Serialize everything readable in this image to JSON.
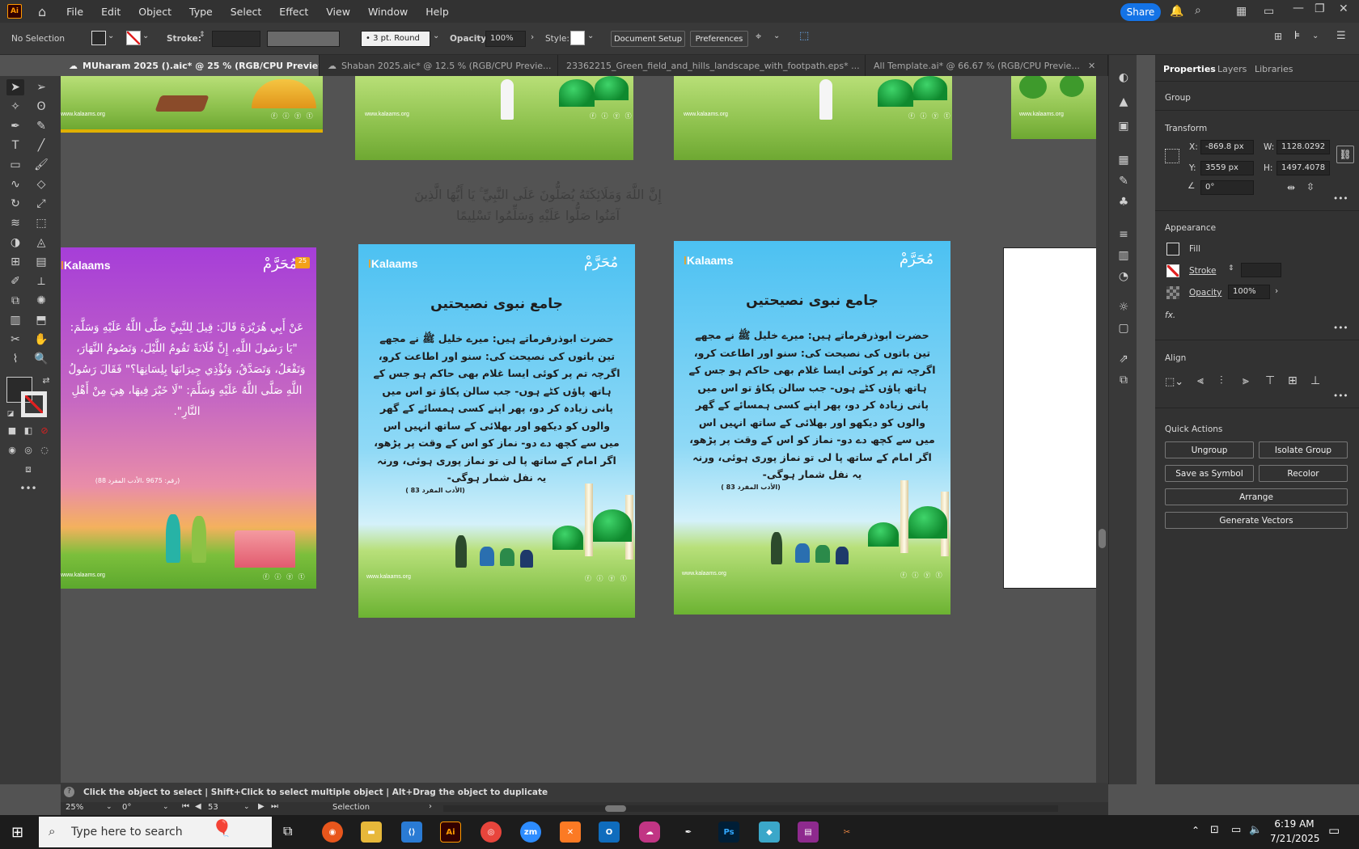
{
  "app": {
    "logo": "Ai",
    "menus": [
      "File",
      "Edit",
      "Object",
      "Type",
      "Select",
      "Effect",
      "View",
      "Window",
      "Help"
    ],
    "share_label": "Share"
  },
  "control": {
    "selection": "No Selection",
    "stroke_label": "Stroke:",
    "brush": "3 pt. Round",
    "opacity_label": "Opacity:",
    "opacity_value": "100%",
    "style_label": "Style:",
    "doc_setup": "Document Setup",
    "preferences": "Preferences"
  },
  "tabs": [
    {
      "label": "MUharam 2025 ().aic* @ 25 % (RGB/CPU Preview)",
      "active": true
    },
    {
      "label": "Shaban 2025.aic* @ 12.5 % (RGB/CPU Previe...",
      "active": false
    },
    {
      "label": "23362215_Green_field_and_hills_landscape_with_footpath.eps* ...",
      "active": false
    },
    {
      "label": "All Template.ai* @ 66.67 % (RGB/CPU Previe...",
      "active": false
    }
  ],
  "canvas": {
    "verse_line1": "إِنَّ اللَّهَ وَمَلَائِكَتَهُ يُصَلُّونَ عَلَى النَّبِيِّ ۚ يَا أَيُّهَا الَّذِينَ",
    "verse_line2": "آمَنُوا صَلُّوا عَلَيْهِ وَسَلِّمُوا تَسْلِيمًا",
    "brand": "Kalaams",
    "site": "www.kalaams.org",
    "socials": "ⓕ ⓘ ⓨ ⓣ",
    "muharram": "مُحَرَّمْ",
    "day": "25",
    "card1_text": "عَنْ أَبِي هُرَيْرَةَ قَالَ: قِيلَ لِلنَّبِيِّ صَلَّى اللَّهُ عَلَيْهِ وَسَلَّمَ: \"يَا رَسُولَ اللَّهِ، إِنَّ فُلَانَةً تَقُومُ اللَّيْلَ، وَتَصُومُ النَّهَارَ، وَتَفْعَلُ، وَتَصَدَّقُ، وَتُؤْذِي جِيرَانَهَا بِلِسَانِهَا؟\" فَقَالَ رَسُولُ اللَّهِ صَلَّى اللَّهُ عَلَيْهِ وَسَلَّمَ: \"لَا خَيْرَ فِيهَا، هِيَ مِنْ أَهْلِ النَّارِ\".",
    "card1_ref": "(رقم: 9675 ،الأدب المفرد 88)",
    "card_title": "جامع نبوی نصیحتیں",
    "card_body": "حضرت ابوذرفرماتے ہیں: میرے خلیل ﷺ نے مجھے تین باتوں کی نصیحت کی: سنو اور اطاعت کرو، اگرچہ تم پر کوئی ایسا غلام بھی حاکم ہو جس کے ہاتھ پاؤں کٹے ہوں- جب سالن پکاؤ تو اس میں پانی زیادہ کر دو، پھر اپنے کسی ہمسائے کے گھر والوں کو دیکھو اور بھلائی کے ساتھ انہیں اس میں سے کچھ دے دو- نماز کو اس کے وقت پر پڑھو، اگر امام کے ساتھ پا لی تو نماز پوری ہوئی، ورنہ یہ نفل شمار ہوگی-",
    "card_ref": "(الأدب المفرد 83 )"
  },
  "panel": {
    "tabs": [
      "Properties",
      "Layers",
      "Libraries"
    ],
    "group": "Group",
    "transform": "Transform",
    "x_label": "X:",
    "x": "-869.8 px",
    "y_label": "Y:",
    "y": "3559 px",
    "w_label": "W:",
    "w": "1128.0292",
    "h_label": "H:",
    "h": "1497.4078",
    "angle": "0°",
    "appearance": "Appearance",
    "fill": "Fill",
    "stroke": "Stroke",
    "opacity": "Opacity",
    "opacity_value": "100%",
    "fx": "fx.",
    "align": "Align",
    "quick_actions": "Quick Actions",
    "ungroup": "Ungroup",
    "isolate": "Isolate Group",
    "save_symbol": "Save as Symbol",
    "recolor": "Recolor",
    "arrange": "Arrange",
    "generate": "Generate Vectors",
    "more": "•••"
  },
  "status": {
    "hint": "Click the object to select  |  Shift+Click to select multiple object  |  Alt+Drag the object to duplicate",
    "zoom": "25%",
    "rotation": "0°",
    "artboard": "53",
    "mode": "Selection"
  },
  "taskbar": {
    "search_placeholder": "Type here to search",
    "time": "6:19 AM",
    "date": "7/21/2025"
  },
  "colors": {
    "accent": "#1473e6",
    "mosque_green": "#0f8a2e",
    "brand_orange": "#f3a11a"
  }
}
